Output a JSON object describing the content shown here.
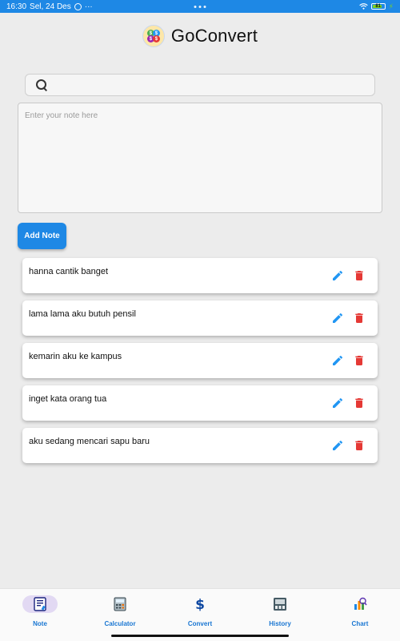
{
  "status_bar": {
    "time": "16:30",
    "date": "Sel, 24 Des",
    "more": "···",
    "battery": "81"
  },
  "app": {
    "title": "GoConvert"
  },
  "search": {
    "placeholder": "",
    "value": ""
  },
  "note_input": {
    "placeholder": "Enter your note here",
    "value": ""
  },
  "add_button": {
    "label": "Add Note"
  },
  "notes": [
    {
      "text": "hanna cantik banget"
    },
    {
      "text": "lama lama aku butuh pensil"
    },
    {
      "text": "kemarin aku ke kampus"
    },
    {
      "text": "inget kata orang tua"
    },
    {
      "text": "aku sedang mencari sapu baru"
    }
  ],
  "nav": {
    "items": [
      {
        "label": "Note",
        "icon": "note-icon",
        "active": true
      },
      {
        "label": "Calculator",
        "icon": "calculator-icon",
        "active": false
      },
      {
        "label": "Convert",
        "icon": "dollar-icon",
        "active": false
      },
      {
        "label": "History",
        "icon": "history-icon",
        "active": false
      },
      {
        "label": "Chart",
        "icon": "chart-icon",
        "active": false
      }
    ]
  },
  "colors": {
    "primary": "#1e88e5",
    "edit": "#2196f3",
    "delete": "#e53935",
    "background": "#ececec",
    "nav_active_bg": "#e2d9f3"
  }
}
